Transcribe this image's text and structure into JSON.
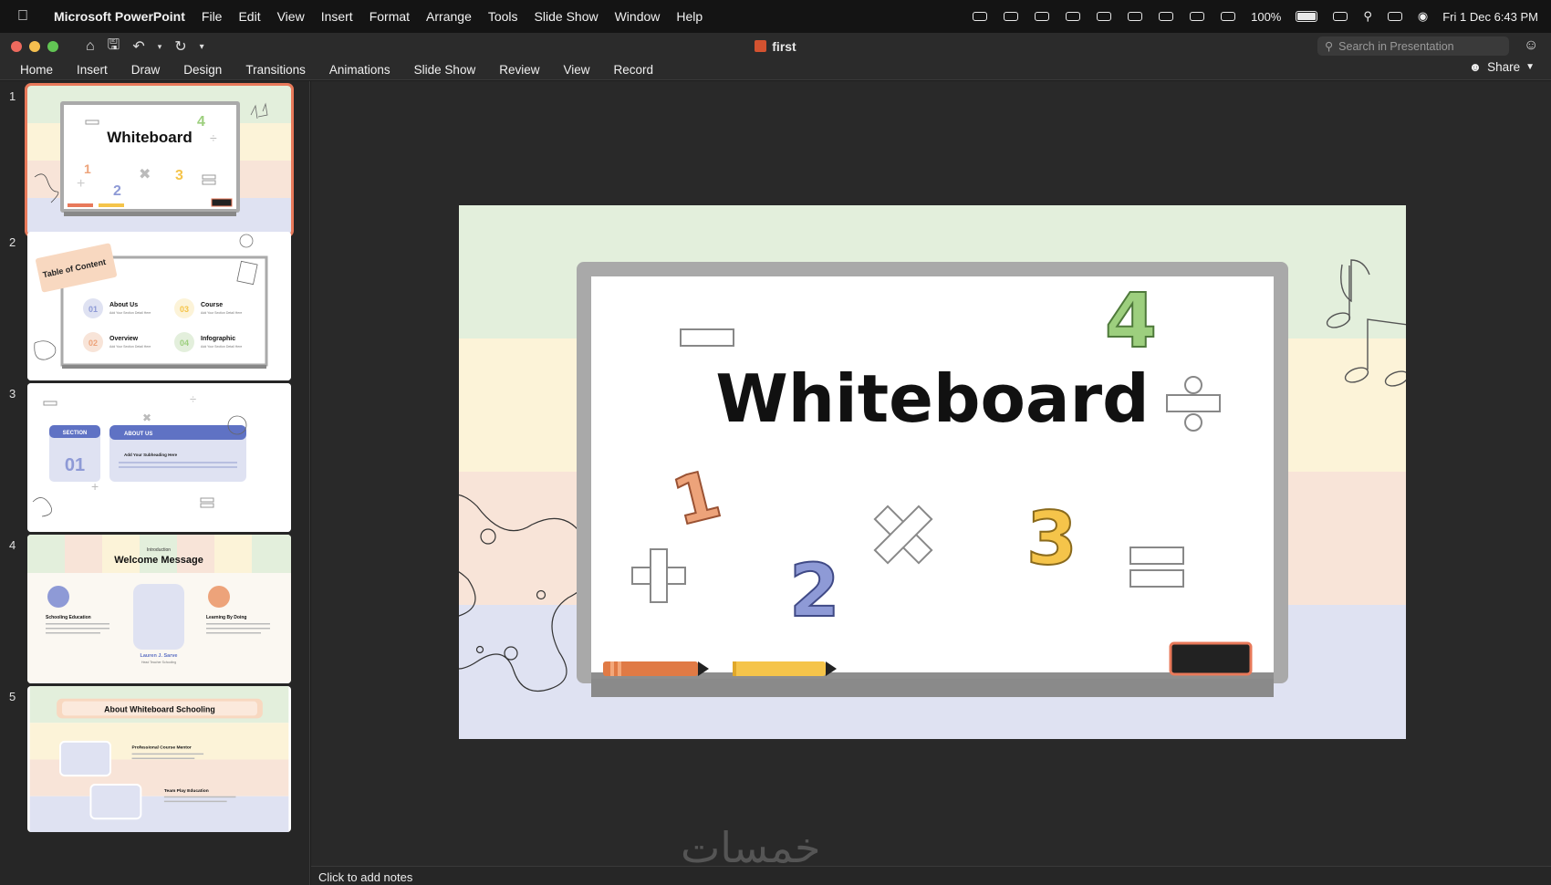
{
  "menubar": {
    "apple": "",
    "app_name": "Microsoft PowerPoint",
    "items": [
      "File",
      "Edit",
      "View",
      "Insert",
      "Format",
      "Arrange",
      "Tools",
      "Slide Show",
      "Window",
      "Help"
    ],
    "battery": "100%",
    "datetime": "Fri 1 Dec  6:43 PM"
  },
  "window": {
    "title": "first",
    "search_placeholder": "Search in Presentation"
  },
  "ribbon": {
    "tabs": [
      "Home",
      "Insert",
      "Draw",
      "Design",
      "Transitions",
      "Animations",
      "Slide Show",
      "Review",
      "View",
      "Record"
    ],
    "share": "Share"
  },
  "thumbnails": [
    {
      "num": "1",
      "title": "Whiteboard"
    },
    {
      "num": "2",
      "title": "Table of Content",
      "items": [
        {
          "n": "01",
          "label": "About Us",
          "sub": "Add Your Section Detail Here"
        },
        {
          "n": "03",
          "label": "Course",
          "sub": "Add Your Section Detail Here"
        },
        {
          "n": "02",
          "label": "Overview",
          "sub": "Add Your Section Detail Here"
        },
        {
          "n": "04",
          "label": "Infographic",
          "sub": "Add Your Section Detail Here"
        }
      ]
    },
    {
      "num": "3",
      "section": "SECTION",
      "section_num": "01",
      "about": "ABOUT US",
      "subheading": "Add Your Subheading Here"
    },
    {
      "num": "4",
      "kicker": "Introduction",
      "title": "Welcome Message",
      "left": "Schooling Education",
      "right": "Learning By Doing",
      "name": "Lauren J. Sarve",
      "role": "Head Teacher Schooling"
    },
    {
      "num": "5",
      "title": "About Whiteboard Schooling",
      "item1": "Professional Course Mentor",
      "item2": "Team Play Education"
    }
  ],
  "slide": {
    "title": "Whiteboard",
    "digits": [
      "1",
      "2",
      "3",
      "4"
    ]
  },
  "notes": {
    "placeholder": "Click to add notes"
  },
  "watermark": "خمسات",
  "colors": {
    "band_green": "#e3efdc",
    "band_yellow": "#fcf3d8",
    "band_peach": "#f8e4d8",
    "band_blue": "#dfe2f2",
    "accent_orange": "#e8795a",
    "digit_green": "#9dcf7e",
    "digit_orange": "#eda37a",
    "digit_blue": "#8e9ad6",
    "digit_yellow": "#f5c44a"
  }
}
